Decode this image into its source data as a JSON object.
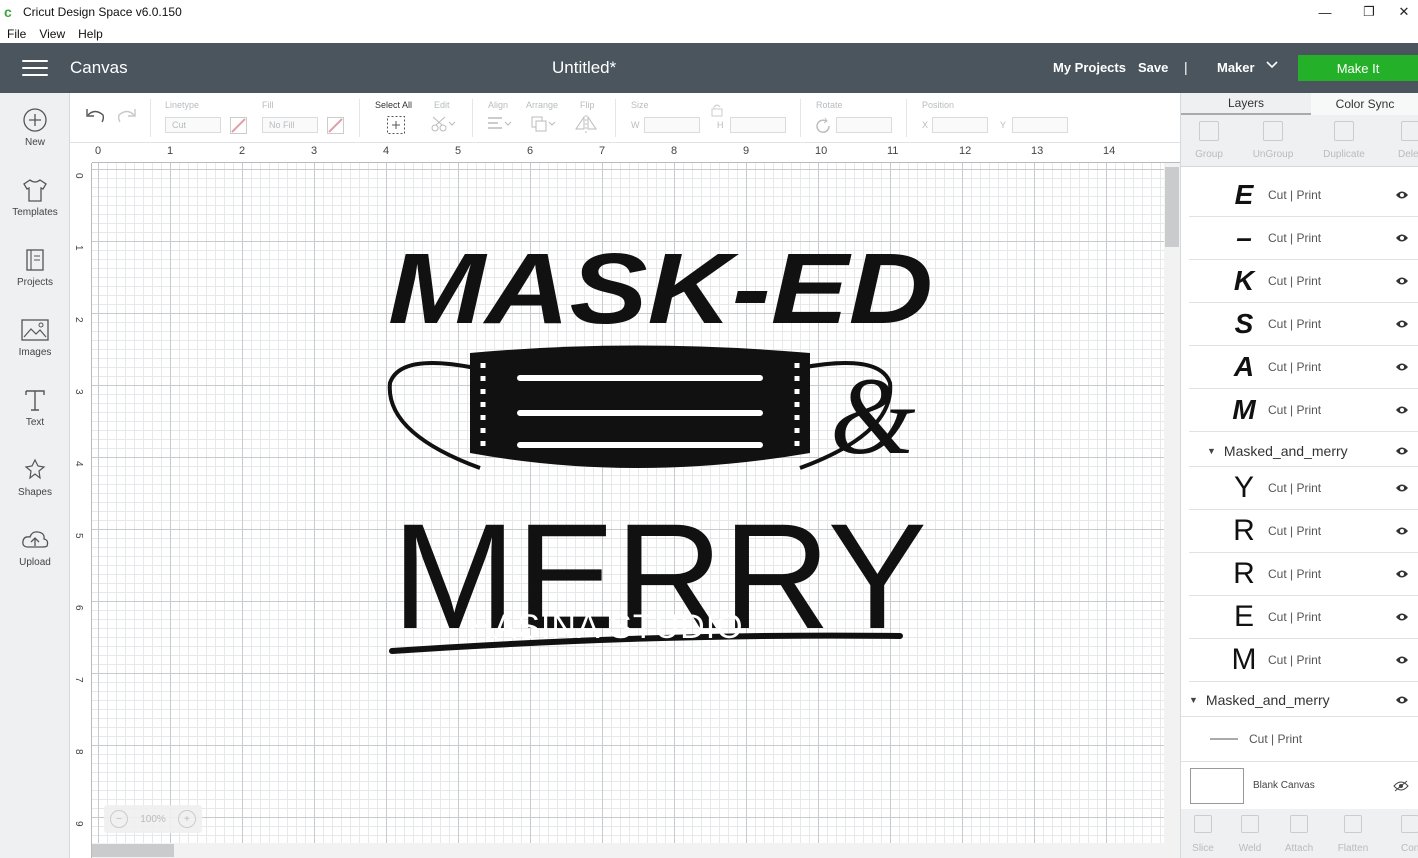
{
  "window": {
    "title": "Cricut Design Space  v6.0.150",
    "minimize": "—",
    "restore": "❐",
    "close": "✕"
  },
  "menu": [
    "File",
    "View",
    "Help"
  ],
  "header": {
    "section": "Canvas",
    "doc_title": "Untitled*",
    "my_projects": "My Projects",
    "save": "Save",
    "separator": "|",
    "machine": "Maker",
    "make_it": "Make It"
  },
  "sidebar": [
    {
      "label": "New",
      "icon": "plus-circle-icon"
    },
    {
      "label": "Templates",
      "icon": "tshirt-icon"
    },
    {
      "label": "Projects",
      "icon": "projects-icon"
    },
    {
      "label": "Images",
      "icon": "image-icon"
    },
    {
      "label": "Text",
      "icon": "text-icon"
    },
    {
      "label": "Shapes",
      "icon": "shapes-icon"
    },
    {
      "label": "Upload",
      "icon": "upload-cloud-icon"
    }
  ],
  "toolbar": {
    "linetype_label": "Linetype",
    "linetype_value": "Cut",
    "fill_label": "Fill",
    "fill_value": "No Fill",
    "select_all": "Select All",
    "edit": "Edit",
    "align": "Align",
    "arrange": "Arrange",
    "flip": "Flip",
    "size": "Size",
    "size_w": "W",
    "size_h": "H",
    "rotate": "Rotate",
    "position": "Position",
    "pos_x": "X",
    "pos_y": "Y"
  },
  "canvas": {
    "ruler_top": [
      "0",
      "1",
      "2",
      "3",
      "4",
      "5",
      "6",
      "7",
      "8",
      "9",
      "10",
      "11",
      "12",
      "13",
      "14"
    ],
    "ruler_left": [
      "0",
      "1",
      "2",
      "3",
      "4",
      "5",
      "6",
      "7",
      "8",
      "9"
    ],
    "zoom": "100%",
    "zoom_minus": "−",
    "zoom_plus": "+",
    "design_top": "MASK-ED",
    "design_bottom": "MERRY",
    "design_amp": "&",
    "watermark": "HASINA STUDIO"
  },
  "panel": {
    "tabs": [
      "Layers",
      "Color Sync"
    ],
    "tools": [
      "Group",
      "UnGroup",
      "Duplicate",
      "Delete"
    ],
    "layers_top": [
      {
        "glyph": "E",
        "label": "Cut | Print"
      },
      {
        "glyph": "–",
        "label": "Cut | Print"
      },
      {
        "glyph": "K",
        "label": "Cut | Print"
      },
      {
        "glyph": "S",
        "label": "Cut | Print"
      },
      {
        "glyph": "A",
        "label": "Cut | Print"
      },
      {
        "glyph": "M",
        "label": "Cut | Print"
      }
    ],
    "group1": "Masked_and_merry",
    "layers_mid": [
      {
        "glyph": "Y",
        "label": "Cut | Print"
      },
      {
        "glyph": "R",
        "label": "Cut | Print"
      },
      {
        "glyph": "R",
        "label": "Cut | Print"
      },
      {
        "glyph": "E",
        "label": "Cut | Print"
      },
      {
        "glyph": "M",
        "label": "Cut | Print"
      }
    ],
    "group2": "Masked_and_merry",
    "line_layer": "Cut | Print",
    "blank_canvas": "Blank Canvas",
    "bottom_tools": [
      "Slice",
      "Weld",
      "Attach",
      "Flatten",
      "Contour"
    ]
  }
}
